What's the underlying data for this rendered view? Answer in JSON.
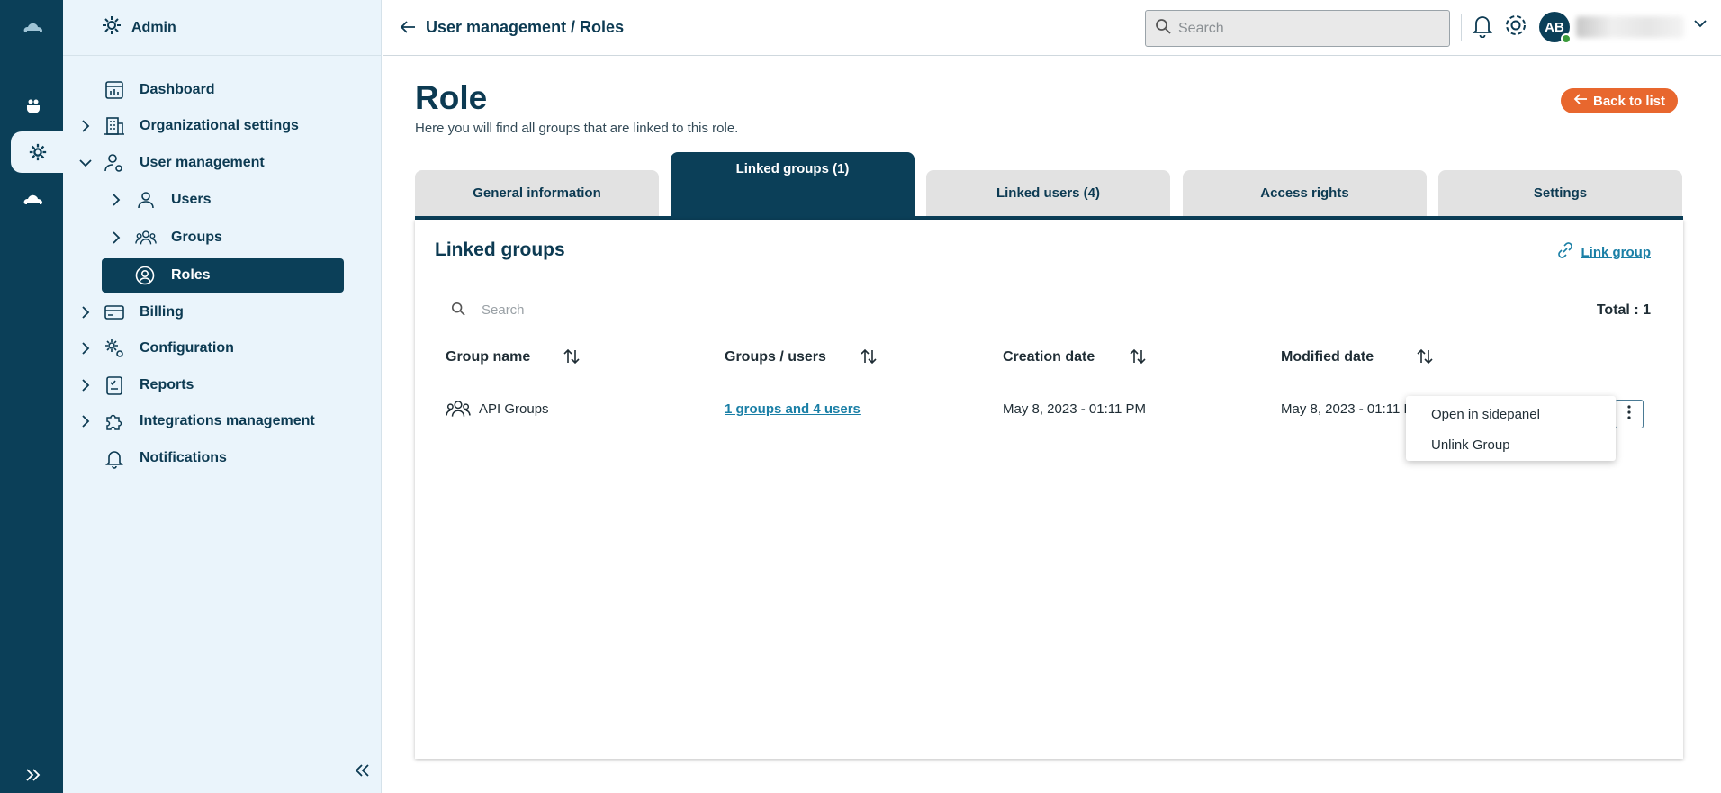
{
  "rail": {
    "items": [
      {
        "icon": "cloud-logo-icon"
      },
      {
        "icon": "puzzle-hand-icon"
      },
      {
        "icon": "gear-icon",
        "active": true
      },
      {
        "icon": "cloud-icon"
      }
    ]
  },
  "sidebar": {
    "header": "Admin",
    "items": [
      {
        "label": "Dashboard"
      },
      {
        "label": "Organizational settings"
      },
      {
        "label": "User management"
      },
      {
        "label": "Users"
      },
      {
        "label": "Groups"
      },
      {
        "label": "Roles"
      },
      {
        "label": "Billing"
      },
      {
        "label": "Configuration"
      },
      {
        "label": "Reports"
      },
      {
        "label": "Integrations management"
      },
      {
        "label": "Notifications"
      }
    ]
  },
  "topbar": {
    "breadcrumb": "User management / Roles",
    "search_placeholder": "Search",
    "avatar_initials": "AB"
  },
  "page": {
    "title": "Role",
    "subtitle": "Here you will find all groups that are linked to this role.",
    "back_label": "Back to list"
  },
  "tabs": [
    {
      "label": "General information"
    },
    {
      "label": "Linked groups (1)",
      "active": true
    },
    {
      "label": "Linked users (4)"
    },
    {
      "label": "Access rights"
    },
    {
      "label": "Settings"
    }
  ],
  "card": {
    "title": "Linked groups",
    "link_label": "Link group",
    "search_placeholder": "Search",
    "total": "Total : 1",
    "columns": [
      "Group name",
      "Groups / users",
      "Creation date",
      "Modified date"
    ],
    "rows": [
      {
        "name": "API Groups",
        "members": "1 groups and 4 users",
        "created": "May 8, 2023 - 01:11 PM",
        "modified": "May 8, 2023 - 01:11 PM"
      }
    ]
  },
  "context_menu": {
    "items": [
      "Open in sidepanel",
      "Unlink Group"
    ]
  },
  "colors": {
    "primary": "#0b3f58",
    "sidebar_bg": "#eaf4fb",
    "accent_orange": "#e8672e",
    "link": "#1a7fa6"
  }
}
